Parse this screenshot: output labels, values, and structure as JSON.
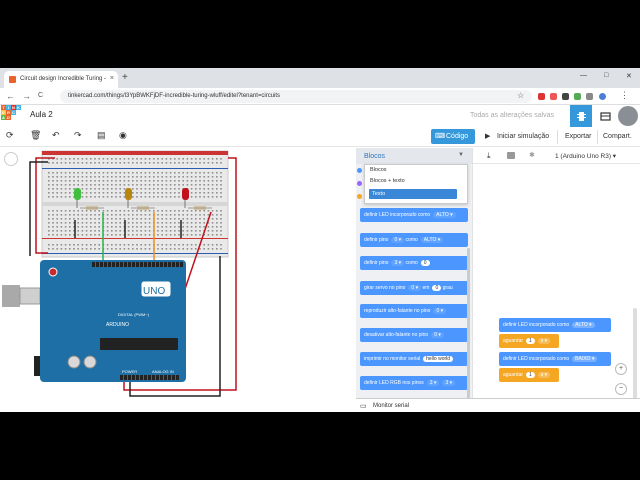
{
  "browser": {
    "tab_title": "Circuit design Incredible Turing -",
    "tab_close": "×",
    "new_tab": "+",
    "win_min": "—",
    "win_max": "□",
    "win_close": "✕",
    "back": "←",
    "forward": "→",
    "reload": "C",
    "url": "tinkercad.com/things/l3YpBWKFjDF-incredible-turing-wluff/editel?tenant=circuits",
    "star": "☆"
  },
  "app": {
    "logo_letters": [
      "T",
      "I",
      "N",
      "K",
      "E",
      "R",
      "C",
      "A",
      "D"
    ],
    "logo_colors": [
      "#e8642c",
      "#46b5e5",
      "#e4312b",
      "#46b5e5",
      "#f7c23e",
      "#e8642c",
      "#46b5e5",
      "#5bba47",
      "#e8642c"
    ],
    "project_title": "Aula 2",
    "save_status": "Todas as alterações salvas",
    "accent": "#3498db"
  },
  "toolbar": {
    "code_label": "Código",
    "sim_label": "Iniciar simulação",
    "export_label": "Exportar",
    "share_label": "Compart."
  },
  "blocks_panel": {
    "header": "Blocos",
    "dropdown_options": [
      "Blocos",
      "Blocos + texto",
      "Texto"
    ],
    "selected_option": "Texto",
    "items": [
      {
        "text": "definir LED incorporado como",
        "pill": "ALTO ▾"
      },
      {
        "text": "definir pino",
        "pill": "0 ▾",
        "text2": "como",
        "pill2": "ALTO ▾"
      },
      {
        "text": "definir pino",
        "pill": "3 ▾",
        "text2": "como",
        "num": "0"
      },
      {
        "text": "girar servo no pino",
        "pill": "0 ▾",
        "text2": "em",
        "num": "0",
        "text3": "grau"
      },
      {
        "text": "reproduzir alto-falante no pino",
        "pill": "0 ▾"
      },
      {
        "text": "desativar alto-falante no pino",
        "pill": "0 ▾"
      },
      {
        "text": "imprimir no monitor serial",
        "num": "hello world"
      },
      {
        "text": "definir LED RGB nos pinos",
        "pill": "3 ▾",
        "pill2": "3 ▾"
      }
    ]
  },
  "code_area": {
    "device": "1 (Arduino Uno R3)",
    "blocks": [
      {
        "text": "definir LED incorporado como",
        "pill": "ALTO ▾",
        "color": "#4c97ff"
      },
      {
        "text": "aguardar",
        "num": "1",
        "pill": "s ▾",
        "color": "#f5a623"
      },
      {
        "text": "definir LED incorporado como",
        "pill": "BAIXO ▾",
        "color": "#4c97ff"
      },
      {
        "text": "aguardar",
        "num": "1",
        "pill": "s ▾",
        "color": "#f5a623"
      }
    ],
    "zoom_in": "+",
    "zoom_out": "−",
    "zoom_reset": "="
  },
  "serial_monitor": "Monitor serial",
  "arduino": {
    "brand": "ARDUINO",
    "model": "UNO",
    "digital_label": "DIGITAL (PWM~)",
    "power_label": "POWER",
    "analog_label": "ANALOG IN",
    "board_color": "#1d6fa5"
  },
  "leds": [
    {
      "color": "#3fbf3f"
    },
    {
      "color": "#b8860b"
    },
    {
      "color": "#c0121c"
    }
  ]
}
